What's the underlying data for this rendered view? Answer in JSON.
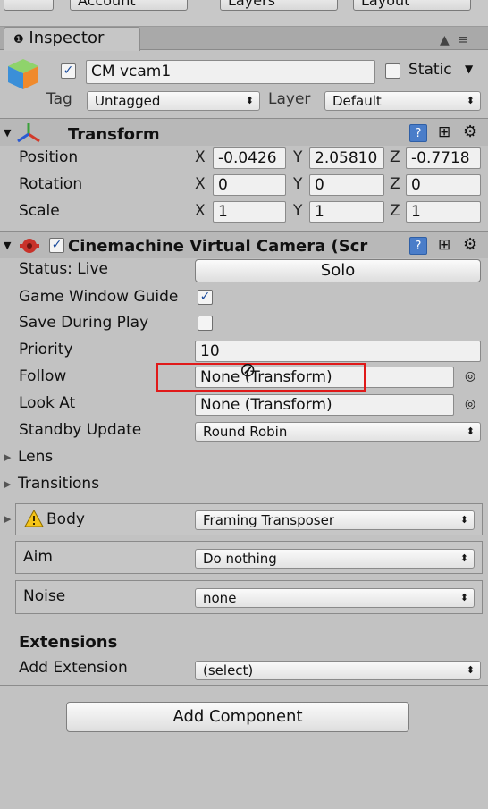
{
  "toolbar": {
    "buttons": [
      "Account",
      "Layers",
      "Layout"
    ]
  },
  "tab": {
    "label": "Inspector"
  },
  "object": {
    "name": "CM vcam1",
    "static_label": "Static",
    "tag_label": "Tag",
    "tag_value": "Untagged",
    "layer_label": "Layer",
    "layer_value": "Default"
  },
  "transform": {
    "title": "Transform",
    "rows": [
      {
        "label": "Position",
        "x": "-0.0426",
        "y": "2.05810",
        "z": "-0.7718"
      },
      {
        "label": "Rotation",
        "x": "0",
        "y": "0",
        "z": "0"
      },
      {
        "label": "Scale",
        "x": "1",
        "y": "1",
        "z": "1"
      }
    ],
    "axes": [
      "X",
      "Y",
      "Z"
    ]
  },
  "vcam": {
    "title": "Cinemachine Virtual Camera (Scr",
    "status_label": "Status: Live",
    "solo_label": "Solo",
    "guide_label": "Game Window Guide",
    "save_label": "Save During Play",
    "priority_label": "Priority",
    "priority_value": "10",
    "follow_label": "Follow",
    "follow_value": "None (Transform)",
    "lookat_label": "Look At",
    "lookat_value": "None (Transform)",
    "standby_label": "Standby Update",
    "standby_value": "Round Robin",
    "lens_label": "Lens",
    "transitions_label": "Transitions",
    "body_label": "Body",
    "body_value": "Framing Transposer",
    "aim_label": "Aim",
    "aim_value": "Do nothing",
    "noise_label": "Noise",
    "noise_value": "none",
    "extensions_label": "Extensions",
    "add_extension_label": "Add Extension",
    "add_extension_value": "(select)"
  },
  "add_component_label": "Add Component",
  "colors": {
    "highlight": "#e01919",
    "checkmark": "#1a4b9c"
  }
}
